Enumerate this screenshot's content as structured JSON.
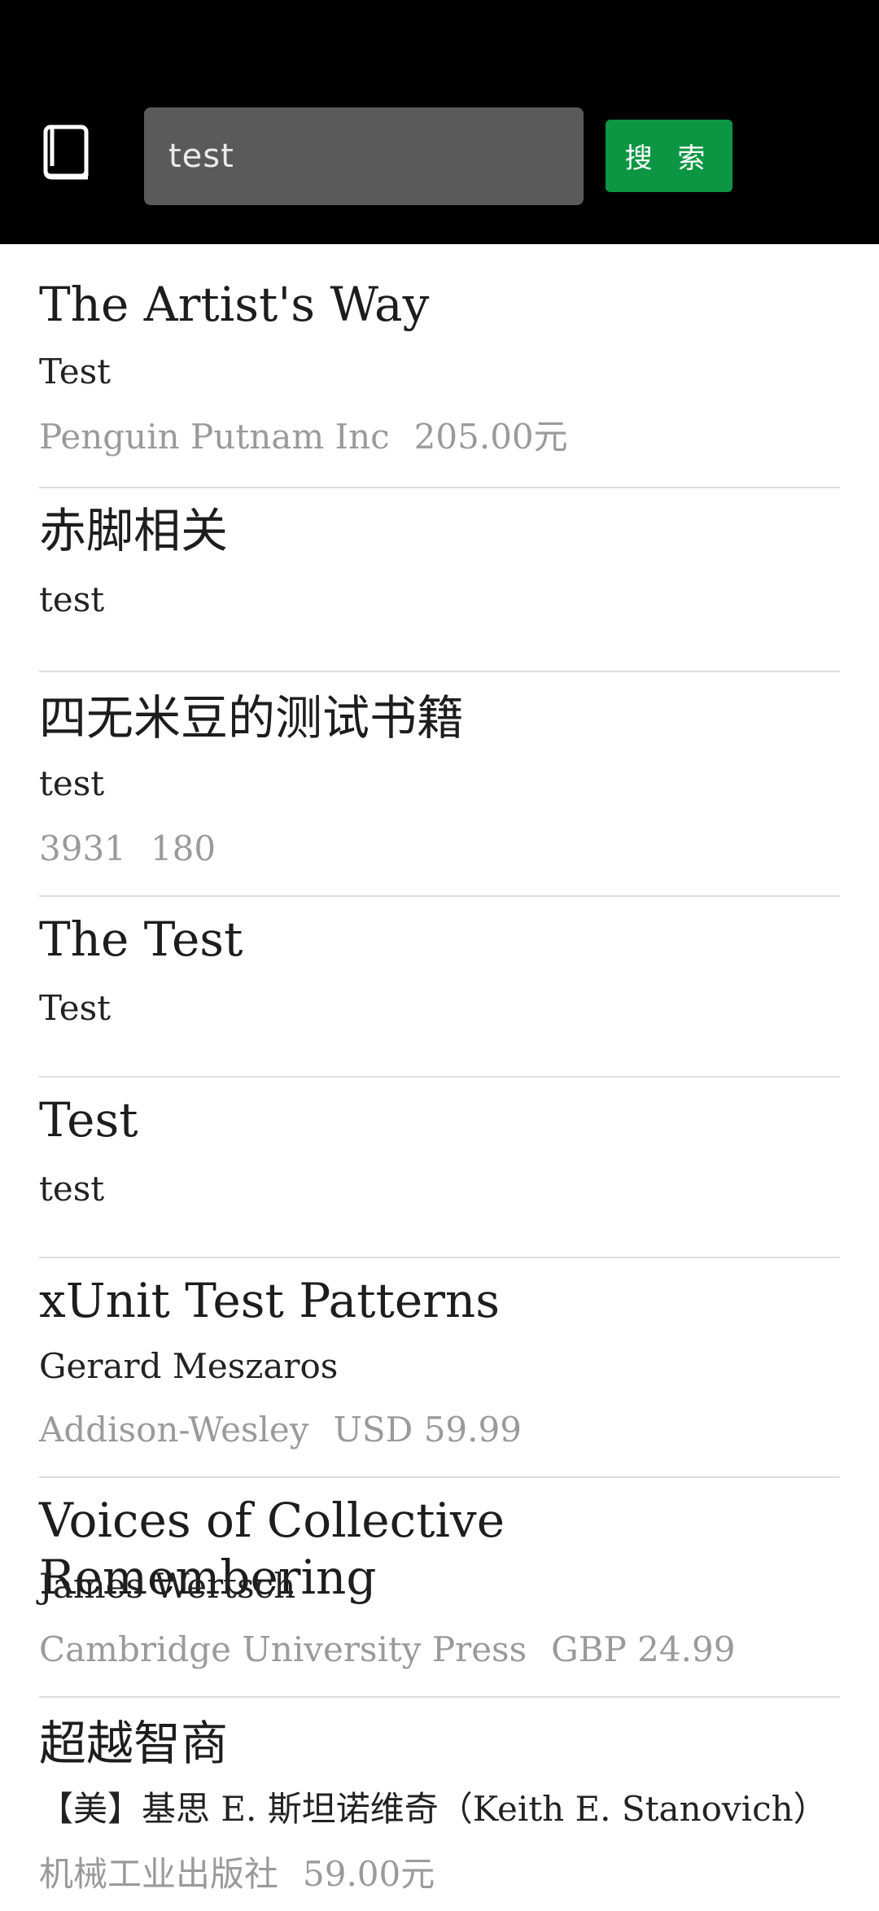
{
  "search": {
    "value": "test",
    "button_label": "搜 索"
  },
  "results": [
    {
      "title": "The Artist's Way",
      "author": "Test",
      "publisher": "Penguin Putnam Inc",
      "price": "205.00元"
    },
    {
      "title": "赤脚相关",
      "author": "test",
      "publisher": "",
      "price": ""
    },
    {
      "title": "四无米豆的测试书籍",
      "author": "test",
      "publisher": "3931",
      "price": "180"
    },
    {
      "title": "The Test",
      "author": "Test",
      "publisher": "",
      "price": ""
    },
    {
      "title": "Test",
      "author": "test",
      "publisher": "",
      "price": ""
    },
    {
      "title": "xUnit Test Patterns",
      "author": "Gerard Meszaros",
      "publisher": "Addison-Wesley",
      "price": "USD 59.99"
    },
    {
      "title": "Voices of Collective Remembering",
      "author": "James Wertsch",
      "publisher": "Cambridge University Press",
      "price": "GBP 24.99"
    },
    {
      "title": "超越智商",
      "author": "【美】基思 E. 斯坦诺维奇（Keith E. Stanovich）",
      "publisher": "机械工业出版社",
      "price": "59.00元"
    }
  ]
}
